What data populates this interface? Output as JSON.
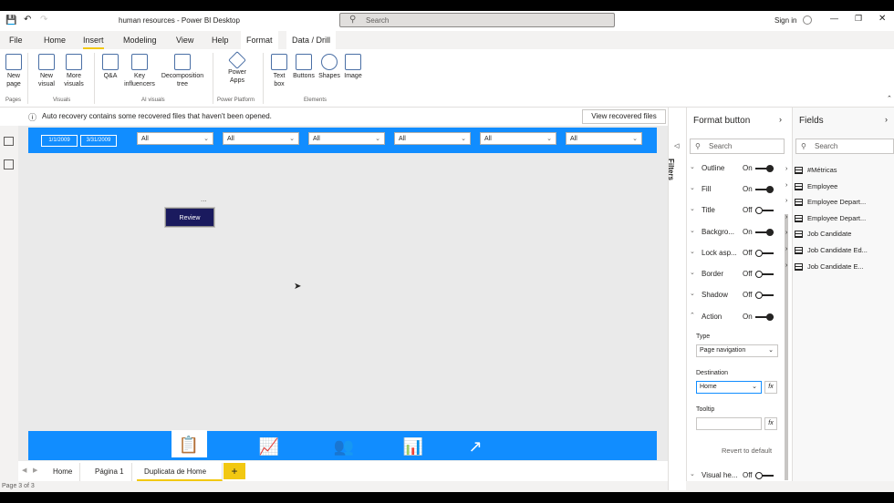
{
  "window": {
    "title": "human resources - Power BI Desktop",
    "search_placeholder": "Search",
    "signin": "Sign in"
  },
  "menu": {
    "file": "File",
    "home": "Home",
    "insert": "Insert",
    "modeling": "Modeling",
    "view": "View",
    "help": "Help",
    "format": "Format",
    "data_drill": "Data / Drill"
  },
  "ribbon": {
    "new_page": "New page",
    "new_visual": "New visual",
    "more_visuals": "More visuals",
    "qa": "Q&A",
    "key_influencers": "Key influencers",
    "decomposition_tree": "Decomposition tree",
    "power_apps": "Power Apps",
    "text_box": "Text box",
    "buttons": "Buttons",
    "shapes": "Shapes",
    "image": "Image",
    "group_pages": "Pages",
    "group_visuals": "Visuals",
    "group_ai": "AI visuals",
    "group_platform": "Power Platform",
    "group_elements": "Elements"
  },
  "notice": {
    "text": "Auto recovery contains some recovered files that haven't been opened.",
    "button": "View recovered files"
  },
  "canvas": {
    "date_start": "1/1/2009",
    "date_end": "3/31/2009",
    "slicers": [
      "All",
      "All",
      "All",
      "All",
      "All",
      "All"
    ],
    "review_button": "Review",
    "more_options": "..."
  },
  "tabs": {
    "home": "Home",
    "pagina1": "Página 1",
    "duplicate": "Duplicata de Home",
    "add": "+"
  },
  "status": {
    "page": "Page 3 of 3"
  },
  "filters": {
    "label": "Filters"
  },
  "format_pane": {
    "title": "Format button",
    "search": "Search",
    "rows": [
      {
        "label": "Outline",
        "state": "On"
      },
      {
        "label": "Fill",
        "state": "On"
      },
      {
        "label": "Title",
        "state": "Off"
      },
      {
        "label": "Backgro...",
        "state": "On"
      },
      {
        "label": "Lock asp...",
        "state": "Off"
      },
      {
        "label": "Border",
        "state": "Off"
      },
      {
        "label": "Shadow",
        "state": "Off"
      },
      {
        "label": "Action",
        "state": "On"
      }
    ],
    "type_label": "Type",
    "type_value": "Page navigation",
    "destination_label": "Destination",
    "destination_value": "Home",
    "tooltip_label": "Tooltip",
    "tooltip_value": "",
    "fx": "fx",
    "revert": "Revert to default",
    "visual_header": {
      "label": "Visual he...",
      "state": "Off"
    }
  },
  "fields_pane": {
    "title": "Fields",
    "search": "Search",
    "items": [
      "#Métricas",
      "Employee",
      "Employee Depart...",
      "Employee Depart...",
      "Job Candidate",
      "Job Candidate Ed...",
      "Job Candidate E..."
    ]
  },
  "colors": {
    "accent_blue": "#118dff",
    "review_bg": "#1a1a5e",
    "tab_yellow": "#f2c811"
  }
}
